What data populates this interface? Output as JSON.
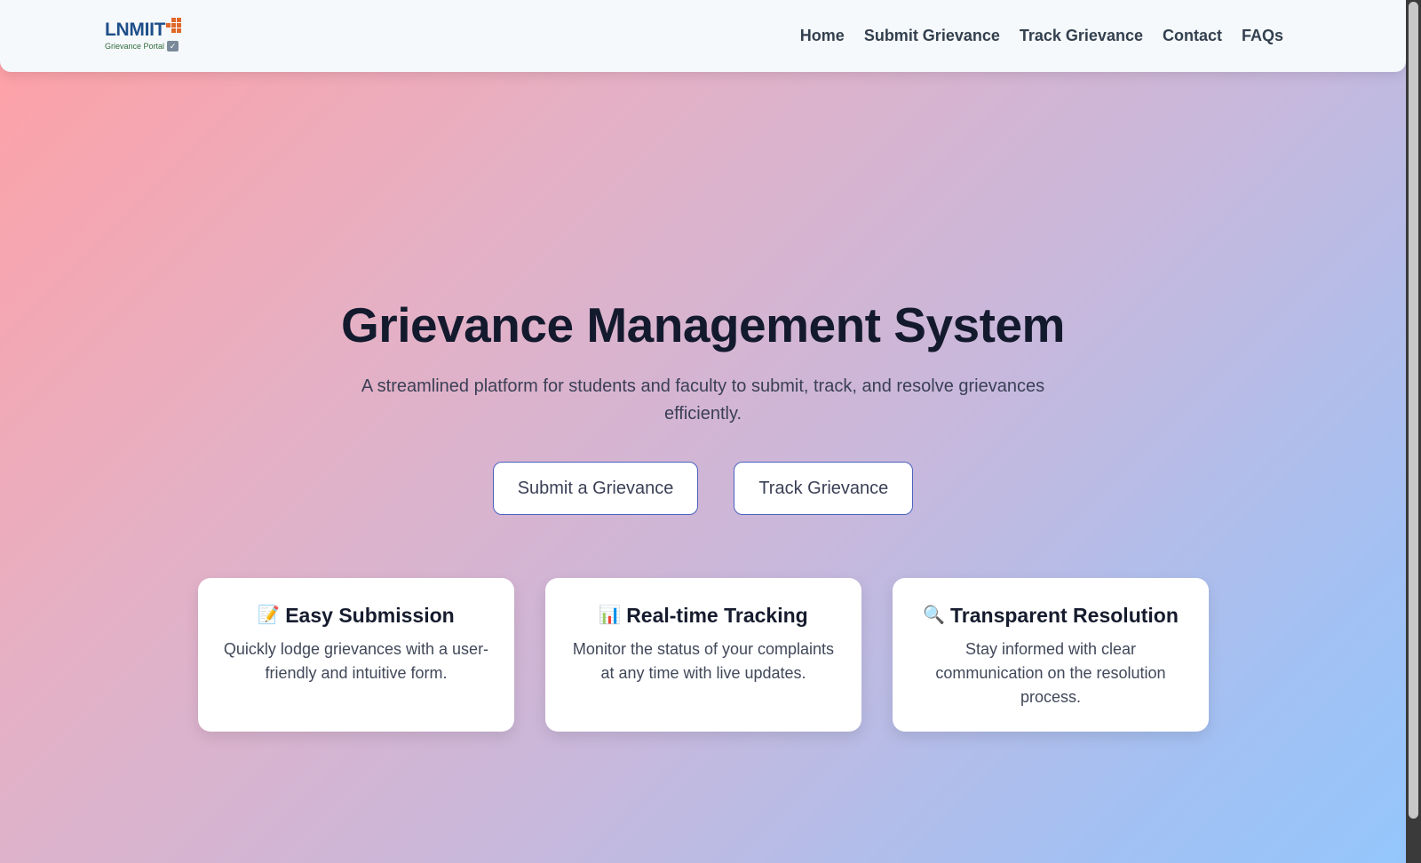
{
  "navbar": {
    "logo": {
      "name": "LNMIIT",
      "subtitle": "Grievance Portal"
    },
    "links": [
      "Home",
      "Submit Grievance",
      "Track Grievance",
      "Contact",
      "FAQs"
    ]
  },
  "hero": {
    "title": "Grievance Management System",
    "subtitle": "A streamlined platform for students and faculty to submit, track, and resolve grievances efficiently.",
    "primary_button": "Submit a Grievance",
    "secondary_button": "Track Grievance"
  },
  "features": [
    {
      "icon": "📝",
      "icon_name": "memo-icon",
      "title": "Easy Submission",
      "description": "Quickly lodge grievances with a user-friendly and intuitive form."
    },
    {
      "icon": "📊",
      "icon_name": "bar-chart-icon",
      "title": "Real-time Tracking",
      "description": "Monitor the status of your complaints at any time with live updates."
    },
    {
      "icon": "🔍",
      "icon_name": "magnifier-icon",
      "title": "Transparent Resolution",
      "description": "Stay informed with clear communication on the resolution process."
    }
  ],
  "colors": {
    "gradient_start": "#ffa0a4",
    "gradient_end": "#94c6fc",
    "button_border": "#4a62c0",
    "logo_blue": "#1f4f8a",
    "logo_orange": "#e0682a"
  }
}
